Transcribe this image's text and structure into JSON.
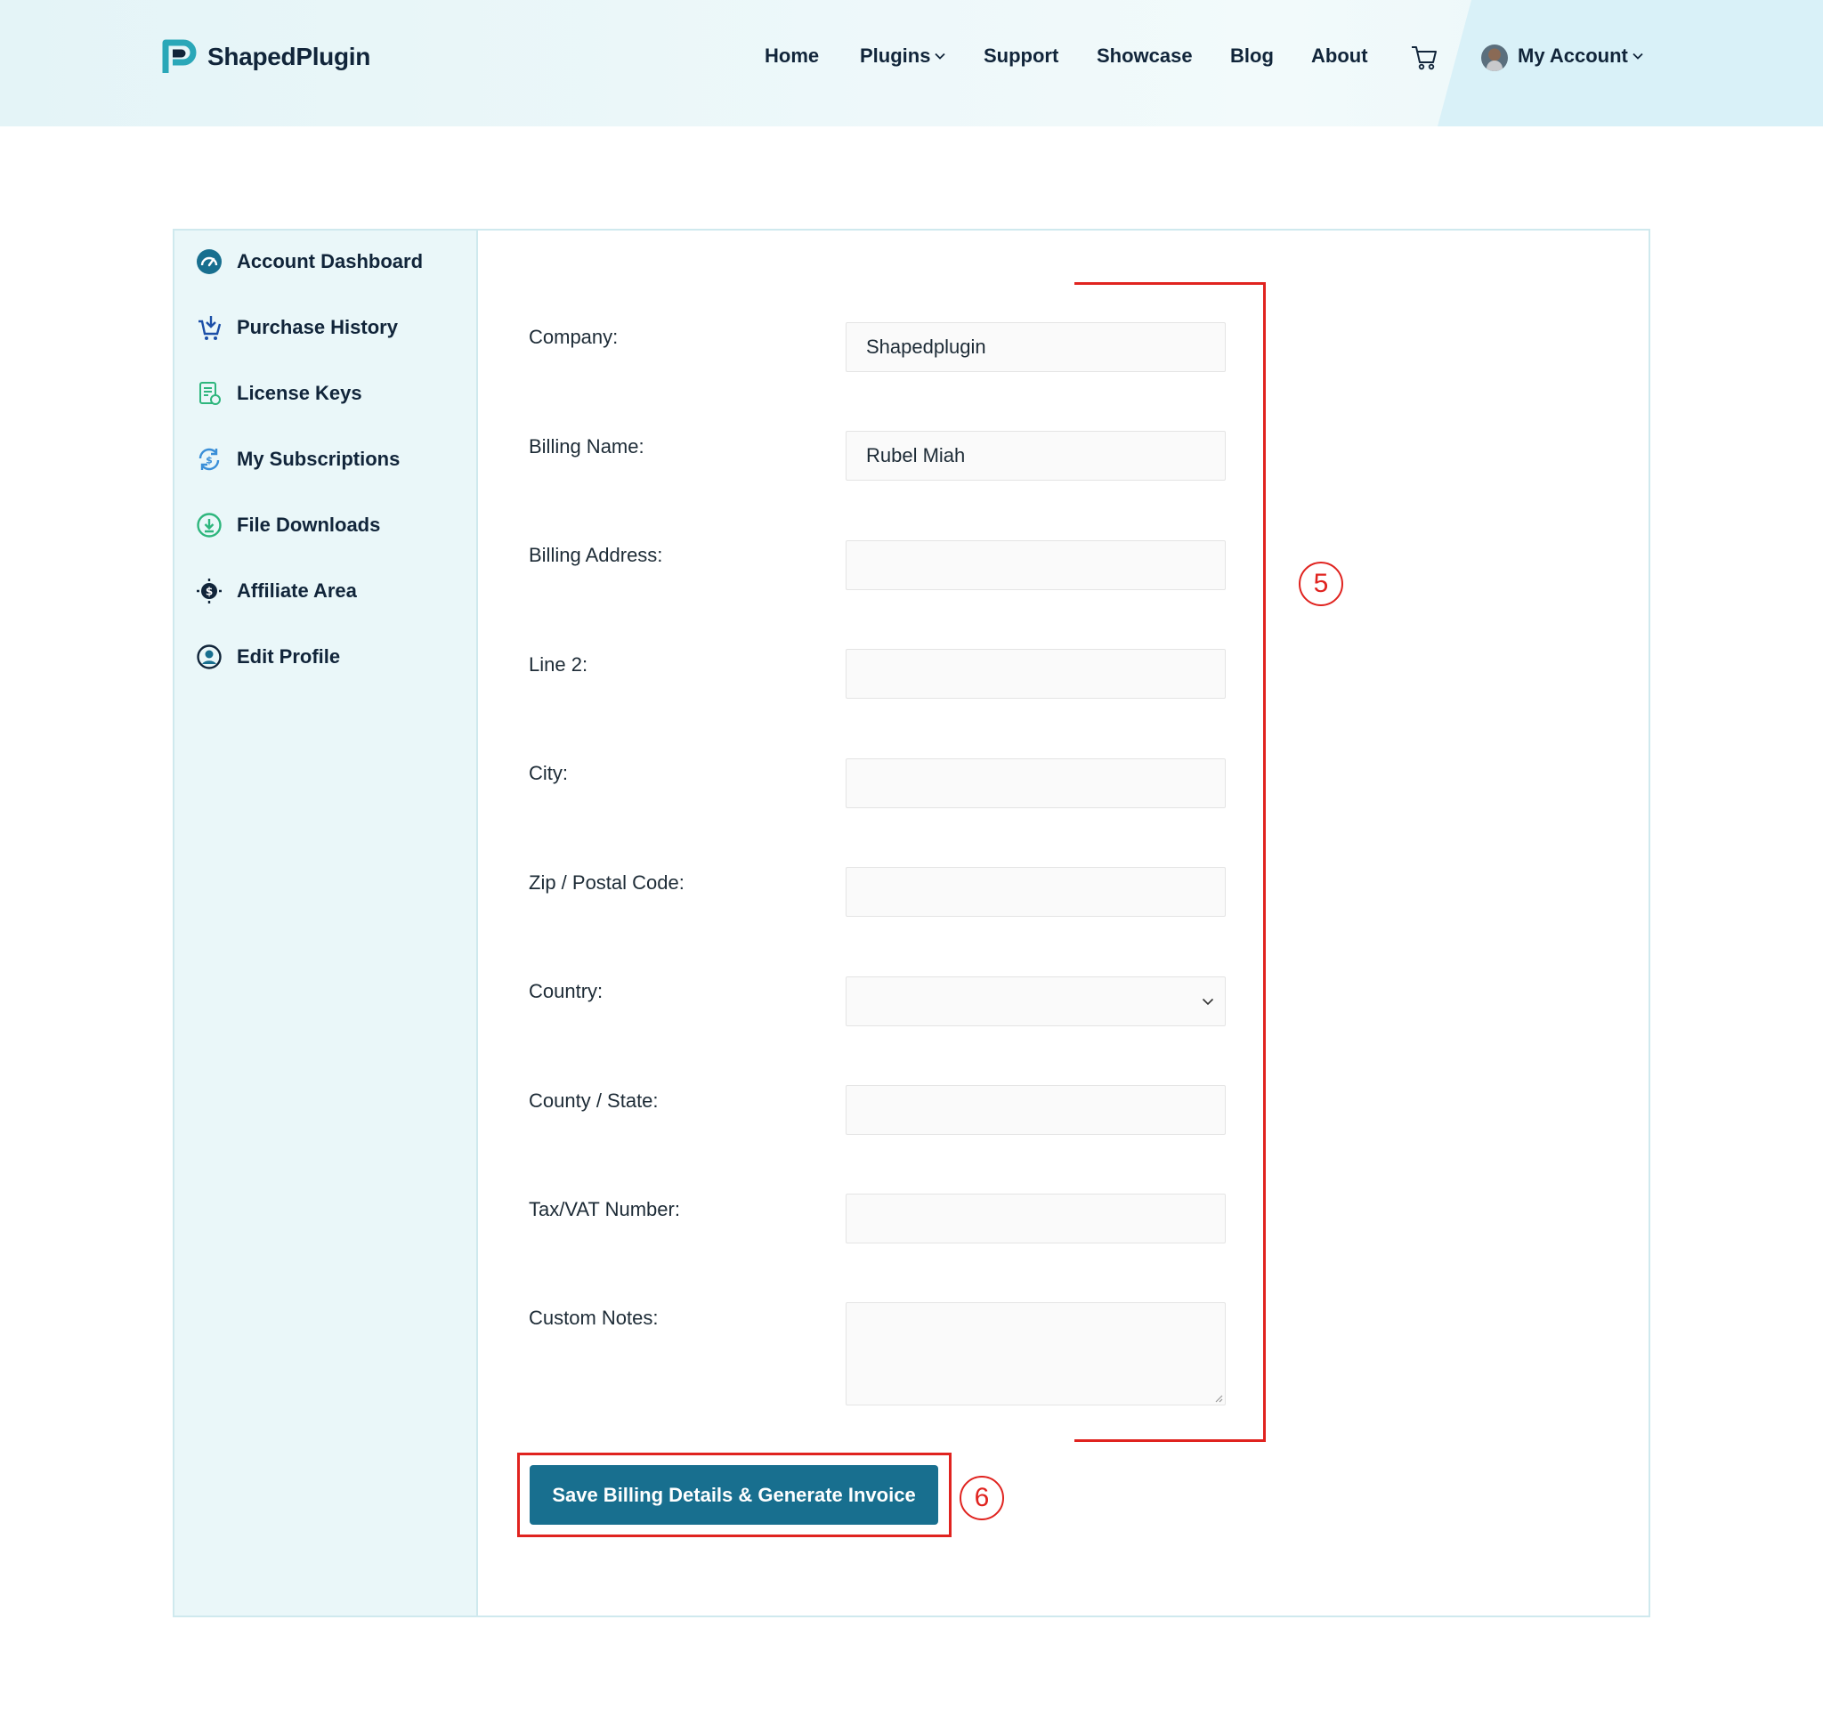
{
  "brand": {
    "name": "ShapedPlugin",
    "accent": "#186f8f",
    "logo_color": "#2aa7b8"
  },
  "nav": {
    "items": [
      {
        "label": "Home"
      },
      {
        "label": "Plugins"
      },
      {
        "label": "Support"
      },
      {
        "label": "Showcase"
      },
      {
        "label": "Blog"
      },
      {
        "label": "About"
      }
    ],
    "cart_icon": "cart-icon",
    "account_label": "My Account"
  },
  "sidebar": {
    "items": [
      {
        "label": "Account Dashboard",
        "icon": "dashboard-gauge-icon"
      },
      {
        "label": "Purchase History",
        "icon": "cart-download-icon"
      },
      {
        "label": "License Keys",
        "icon": "license-document-icon"
      },
      {
        "label": "My Subscriptions",
        "icon": "subscription-refresh-icon"
      },
      {
        "label": "File Downloads",
        "icon": "download-circle-icon"
      },
      {
        "label": "Affiliate Area",
        "icon": "affiliate-dollar-icon"
      },
      {
        "label": "Edit Profile",
        "icon": "user-circle-icon"
      }
    ]
  },
  "form": {
    "company": {
      "label": "Company:",
      "value": "Shapedplugin"
    },
    "billing_name": {
      "label": "Billing Name:",
      "value": "Rubel Miah"
    },
    "billing_address": {
      "label": "Billing Address:",
      "value": ""
    },
    "line2": {
      "label": "Line 2:",
      "value": ""
    },
    "city": {
      "label": "City:",
      "value": ""
    },
    "zip": {
      "label": "Zip / Postal Code:",
      "value": ""
    },
    "country": {
      "label": "Country:",
      "value": ""
    },
    "state": {
      "label": "County / State:",
      "value": ""
    },
    "tax": {
      "label": "Tax/VAT Number:",
      "value": ""
    },
    "notes": {
      "label": "Custom Notes:",
      "value": ""
    },
    "submit_label": "Save Billing Details & Generate Invoice"
  },
  "annotations": {
    "fields_marker": "5",
    "button_marker": "6",
    "color": "#e0231f"
  }
}
